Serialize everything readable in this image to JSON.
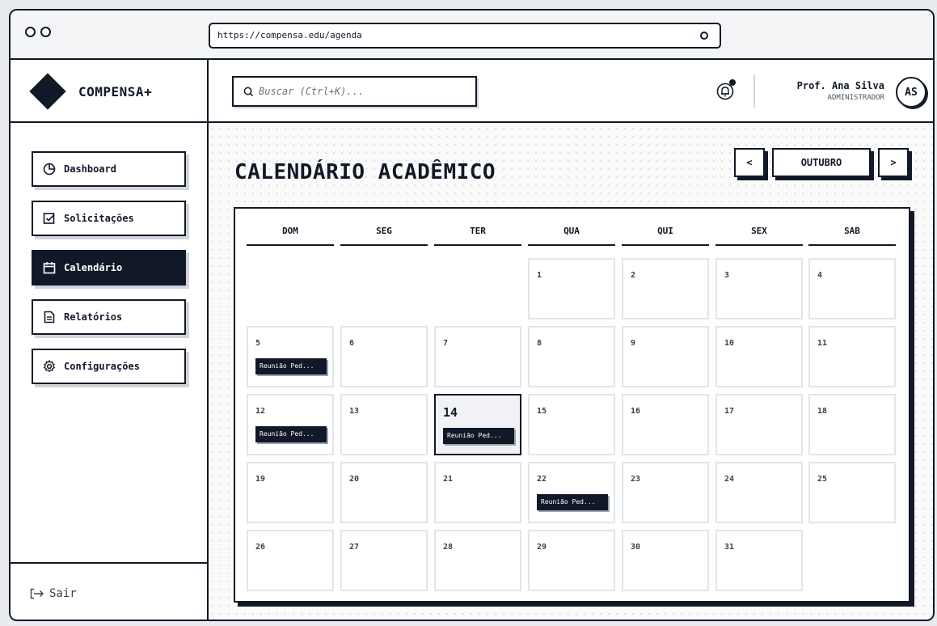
{
  "browser": {
    "url": "https://compensa.edu/agenda"
  },
  "brand": {
    "name": "COMPENSA+"
  },
  "header": {
    "search_placeholder": "Buscar (Ctrl+K)...",
    "user_name": "Prof. Ana Silva",
    "user_role": "ADMINISTRADOR",
    "avatar_initials": "AS"
  },
  "sidebar": {
    "items": [
      {
        "label": "Dashboard",
        "icon": "pie-chart-icon",
        "active": false
      },
      {
        "label": "Solicitações",
        "icon": "checkbox-icon",
        "active": false
      },
      {
        "label": "Calendário",
        "icon": "calendar-icon",
        "active": true
      },
      {
        "label": "Relatórios",
        "icon": "document-icon",
        "active": false
      },
      {
        "label": "Configurações",
        "icon": "gear-icon",
        "active": false
      }
    ],
    "logout_label": "Sair"
  },
  "main": {
    "title": "CALENDÁRIO ACADÊMICO",
    "prev_label": "<",
    "month_label": "OUTUBRO",
    "next_label": ">"
  },
  "calendar": {
    "weekdays": [
      "DOM",
      "SEG",
      "TER",
      "QUA",
      "QUI",
      "SEX",
      "SAB"
    ],
    "today": 14,
    "weeks": [
      [
        null,
        null,
        null,
        {
          "day": "1"
        },
        {
          "day": "2"
        },
        {
          "day": "3"
        },
        {
          "day": "4"
        }
      ],
      [
        {
          "day": "5",
          "event": "Reunião Ped..."
        },
        {
          "day": "6"
        },
        {
          "day": "7"
        },
        {
          "day": "8"
        },
        {
          "day": "9"
        },
        {
          "day": "10"
        },
        {
          "day": "11"
        }
      ],
      [
        {
          "day": "12",
          "event": "Reunião Ped..."
        },
        {
          "day": "13"
        },
        {
          "day": "14",
          "event": "Reunião Ped..."
        },
        {
          "day": "15"
        },
        {
          "day": "16"
        },
        {
          "day": "17"
        },
        {
          "day": "18"
        }
      ],
      [
        {
          "day": "19"
        },
        {
          "day": "20"
        },
        {
          "day": "21"
        },
        {
          "day": "22",
          "event": "Reunião Ped..."
        },
        {
          "day": "23"
        },
        {
          "day": "24"
        },
        {
          "day": "25"
        }
      ],
      [
        {
          "day": "26"
        },
        {
          "day": "27"
        },
        {
          "day": "28"
        },
        {
          "day": "29"
        },
        {
          "day": "30"
        },
        {
          "day": "31"
        },
        null
      ]
    ]
  },
  "colors": {
    "ink": "#111827",
    "cell_border": "#e2e5ec",
    "today_bg": "#f1f2f5"
  }
}
